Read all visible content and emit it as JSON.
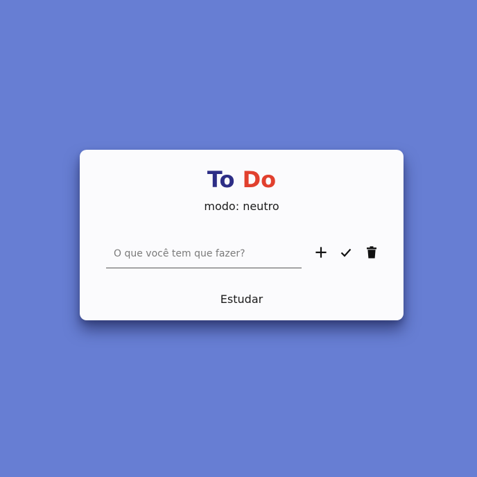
{
  "colors": {
    "background": "#677ed3",
    "card": "#fbfbfd",
    "title_to": "#2d2e86",
    "title_do": "#e1402e"
  },
  "header": {
    "title_to": "To",
    "title_do": "Do",
    "mode_text": "modo: neutro"
  },
  "form": {
    "input_value": "",
    "input_placeholder": "O que você tem que fazer?",
    "add_icon": "plus-icon",
    "check_icon": "check-icon",
    "delete_icon": "trash-icon"
  },
  "tasks": [
    {
      "label": "Estudar"
    }
  ]
}
